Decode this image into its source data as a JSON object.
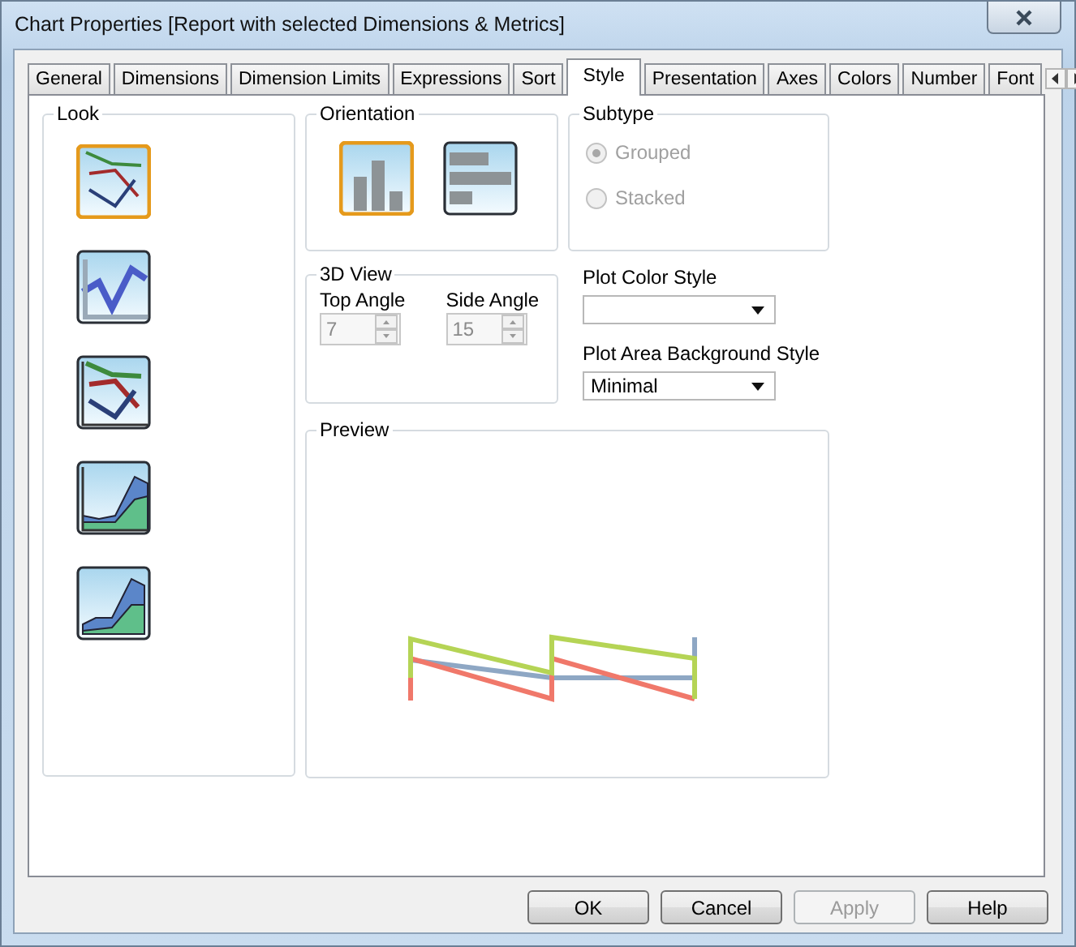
{
  "window": {
    "title": "Chart Properties [Report with selected Dimensions & Metrics]"
  },
  "tabs": [
    {
      "label": "General",
      "selected": false
    },
    {
      "label": "Dimensions",
      "selected": false
    },
    {
      "label": "Dimension Limits",
      "selected": false
    },
    {
      "label": "Expressions",
      "selected": false
    },
    {
      "label": "Sort",
      "selected": false
    },
    {
      "label": "Style",
      "selected": true
    },
    {
      "label": "Presentation",
      "selected": false
    },
    {
      "label": "Axes",
      "selected": false
    },
    {
      "label": "Colors",
      "selected": false
    },
    {
      "label": "Number",
      "selected": false
    },
    {
      "label": "Font",
      "selected": false
    }
  ],
  "look": {
    "label": "Look",
    "options": [
      {
        "kind": "line",
        "selected": true
      },
      {
        "kind": "line-3d",
        "selected": false
      },
      {
        "kind": "line-shadow",
        "selected": false
      },
      {
        "kind": "area",
        "selected": false
      },
      {
        "kind": "area-3d",
        "selected": false
      }
    ]
  },
  "orientation": {
    "label": "Orientation",
    "options": [
      {
        "kind": "vertical",
        "selected": true
      },
      {
        "kind": "horizontal",
        "selected": false
      }
    ]
  },
  "subtype": {
    "label": "Subtype",
    "options": [
      {
        "label": "Grouped",
        "selected": true,
        "disabled": true
      },
      {
        "label": "Stacked",
        "selected": false,
        "disabled": true
      }
    ]
  },
  "view_3d": {
    "label": "3D View",
    "fields": [
      {
        "label": "Top Angle",
        "value": "7",
        "disabled": true
      },
      {
        "label": "Side Angle",
        "value": "15",
        "disabled": true
      }
    ]
  },
  "plot_color_style": {
    "label": "Plot Color Style"
  },
  "plot_area_background_style": {
    "label": "Plot Area Background Style",
    "value": "Minimal"
  },
  "preview": {
    "label": "Preview"
  },
  "buttons": [
    {
      "label": "OK",
      "disabled": false
    },
    {
      "label": "Cancel",
      "disabled": false
    },
    {
      "label": "Apply",
      "disabled": true
    },
    {
      "label": "Help",
      "disabled": false
    }
  ]
}
